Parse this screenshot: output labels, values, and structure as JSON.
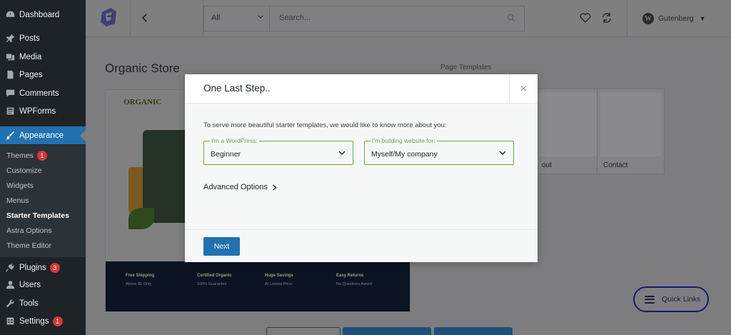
{
  "sidebar": {
    "items": [
      {
        "label": "Dashboard",
        "icon": "dashboard-icon"
      },
      {
        "label": "Posts",
        "icon": "pin-icon"
      },
      {
        "label": "Media",
        "icon": "media-icon"
      },
      {
        "label": "Pages",
        "icon": "pages-icon"
      },
      {
        "label": "Comments",
        "icon": "comment-icon"
      },
      {
        "label": "WPForms",
        "icon": "form-icon"
      },
      {
        "label": "Appearance",
        "icon": "brush-icon"
      },
      {
        "label": "Plugins",
        "icon": "plug-icon",
        "badge": "3"
      },
      {
        "label": "Users",
        "icon": "user-icon"
      },
      {
        "label": "Tools",
        "icon": "wrench-icon"
      },
      {
        "label": "Settings",
        "icon": "settings-icon",
        "badge": "1"
      }
    ],
    "appearance_submenu": [
      {
        "label": "Themes",
        "badge": "1"
      },
      {
        "label": "Customize"
      },
      {
        "label": "Widgets"
      },
      {
        "label": "Menus"
      },
      {
        "label": "Starter Templates",
        "current": true
      },
      {
        "label": "Astra Options"
      },
      {
        "label": "Theme Editor"
      }
    ]
  },
  "topbar": {
    "search_type": "All",
    "search_placeholder": "Search...",
    "page_builder": "Gutenberg"
  },
  "content": {
    "site_title": "Organic Store",
    "page_templates_label": "Page Templates",
    "preview_logo": "ORGANIC",
    "preview_features": [
      {
        "title": "Free Shipping",
        "sub": "Above $5 Only"
      },
      {
        "title": "Certified Organic",
        "sub": "100% Guarantee"
      },
      {
        "title": "Huge Savings",
        "sub": "At Lowest Price"
      },
      {
        "title": "Easy Returns",
        "sub": "No Questions Asked"
      }
    ],
    "thumbnails": [
      {
        "label": ""
      },
      {
        "label": "out"
      },
      {
        "label": "Contact"
      }
    ]
  },
  "quick_links": {
    "label": "Quick Links"
  },
  "modal": {
    "title": "One Last Step..",
    "close": "×",
    "description": "To serve more beautiful starter templates, we would like to know more about you:",
    "field_wp": {
      "legend": "I'm a WordPress:",
      "value": "Beginner"
    },
    "field_site": {
      "legend": "I'm building website for:",
      "value": "Myself/My company"
    },
    "advanced_options": "Advanced Options",
    "next_button": "Next"
  },
  "colors": {
    "accent": "#2271b1",
    "field_border": "#6ea74a",
    "sidebar_bg": "#1d2327",
    "badge": "#d63638",
    "quick_links_border": "#1a1a6e"
  }
}
